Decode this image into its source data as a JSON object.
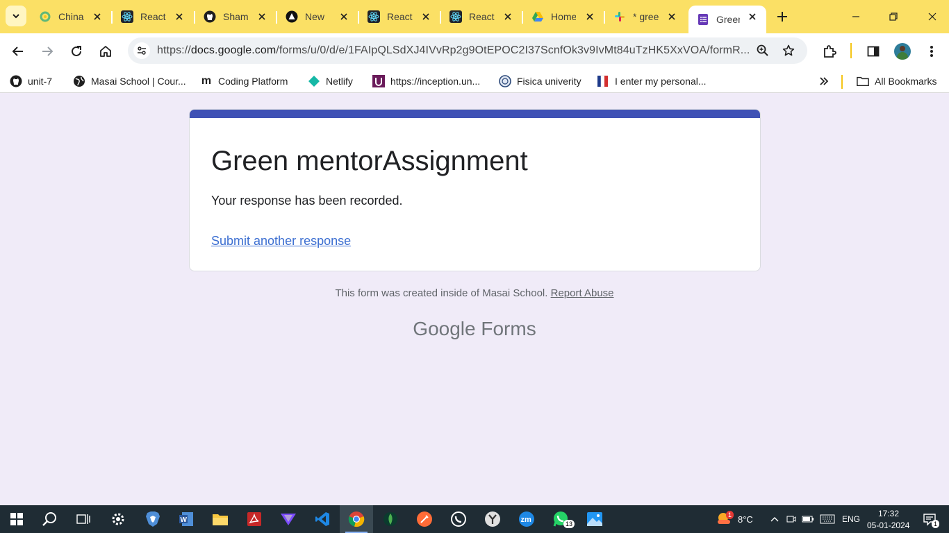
{
  "tabs": [
    {
      "title": "China",
      "icon": "china-loop-icon"
    },
    {
      "title": "React",
      "icon": "react-icon"
    },
    {
      "title": "Sham",
      "icon": "github-icon"
    },
    {
      "title": "New",
      "icon": "new-tab-triangle-icon"
    },
    {
      "title": "React",
      "icon": "react-icon"
    },
    {
      "title": "React",
      "icon": "react-icon"
    },
    {
      "title": "Home",
      "icon": "google-drive-icon"
    },
    {
      "title": "* gree",
      "icon": "slack-icon"
    },
    {
      "title": "Green",
      "icon": "google-forms-icon",
      "active": true
    }
  ],
  "address_bar": {
    "url_host": "docs.google.com",
    "url_path": "/forms/u/0/d/e/1FAIpQLSdXJ4IVvRp2g9OtEPOC2I37ScnfOk3v9IvMt84uTzHK5XxVOA/formR..."
  },
  "bookmarks": [
    {
      "label": "unit-7",
      "icon": "github-icon"
    },
    {
      "label": "Masai School | Cour...",
      "icon": "globe-icon"
    },
    {
      "label": "Coding Platform",
      "icon": "masai-m-icon"
    },
    {
      "label": "Netlify",
      "icon": "netlify-icon"
    },
    {
      "label": "https://inception.un...",
      "icon": "unacademy-icon"
    },
    {
      "label": "Fisica univerity",
      "icon": "university-seal-icon"
    },
    {
      "label": "I enter my personal...",
      "icon": "flag-icon"
    }
  ],
  "all_bookmarks_label": "All Bookmarks",
  "form": {
    "title": "Green mentorAssignment",
    "message": "Your response has been recorded.",
    "link_label": "Submit another response",
    "footer_text": "This form was created inside of Masai School.",
    "report_label": "Report Abuse",
    "brand_google": "Google",
    "brand_forms": "Forms",
    "accent_color": "#3f51b5"
  },
  "taskbar": {
    "weather_temp": "8°C",
    "weather_badge": "1",
    "language": "ENG",
    "time": "17:32",
    "date": "05-01-2024",
    "whatsapp_badge": "13",
    "notification_badge": "1"
  }
}
